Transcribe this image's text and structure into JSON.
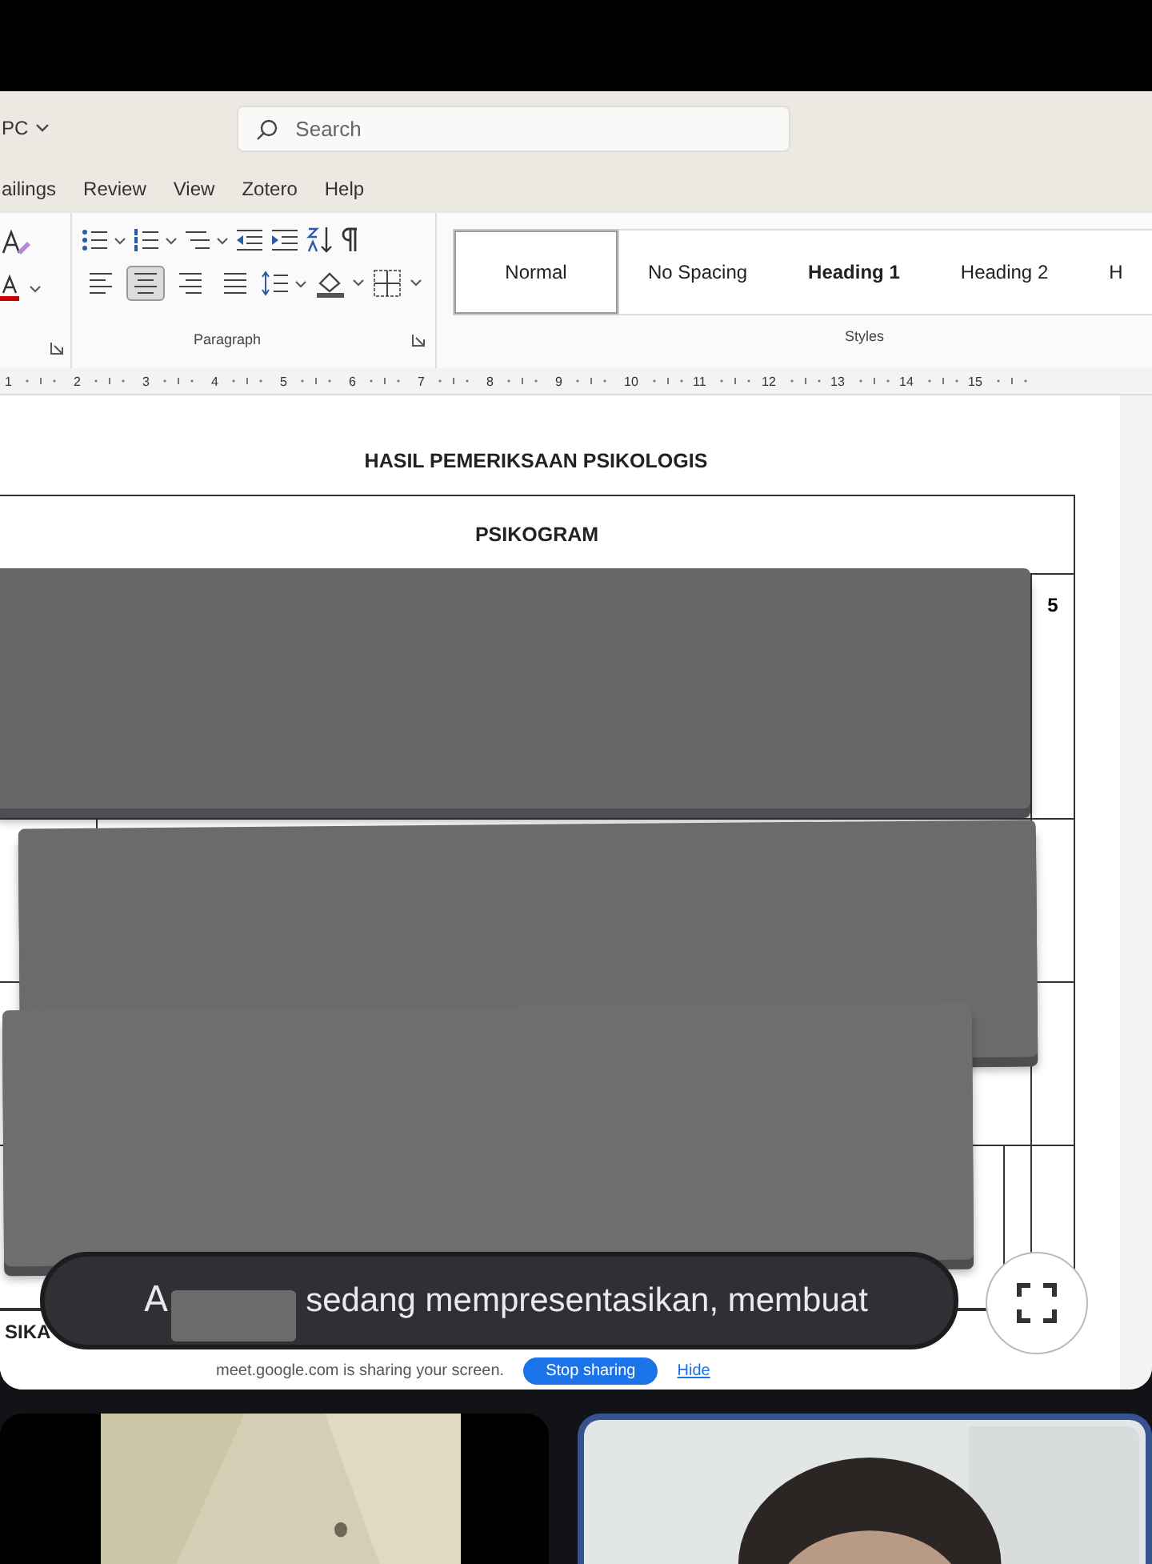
{
  "title_bar": {
    "account": "PC",
    "search": {
      "placeholder": "Search"
    }
  },
  "menu": [
    {
      "label": "ailings"
    },
    {
      "label": "Review"
    },
    {
      "label": "View"
    },
    {
      "label": "Zotero"
    },
    {
      "label": "Help"
    }
  ],
  "ribbon": {
    "paragraph_label": "Paragraph",
    "styles_label": "Styles",
    "alignment": [
      {
        "kind": "left",
        "selected": false
      },
      {
        "kind": "center",
        "selected": true
      },
      {
        "kind": "right",
        "selected": false
      },
      {
        "kind": "justify",
        "selected": false
      }
    ],
    "styles": [
      {
        "label": "Normal",
        "selected": true,
        "bold": false
      },
      {
        "label": "No Spacing",
        "selected": false,
        "bold": false
      },
      {
        "label": "Heading 1",
        "selected": false,
        "bold": true
      },
      {
        "label": "Heading 2",
        "selected": false,
        "bold": false
      },
      {
        "label": "H",
        "selected": false,
        "bold": false
      }
    ]
  },
  "ruler": [
    "1",
    "2",
    "3",
    "4",
    "5",
    "6",
    "7",
    "8",
    "9",
    "10",
    "11",
    "12",
    "13",
    "14",
    "15"
  ],
  "document": {
    "heading": "HASIL PEMERIKSAAN PSIKOLOGIS",
    "table_title": "PSIKOGRAM",
    "score_header": "5",
    "next_section": "SIKA"
  },
  "share_bar": {
    "message": "meet.google.com is sharing your screen.",
    "stop": "Stop sharing",
    "hide": "Hide"
  },
  "caption": {
    "prefix": "A",
    "text": "sedang mempresentasikan, membuat"
  },
  "tiles": [
    {
      "kind": "picture",
      "active": false
    },
    {
      "kind": "picture",
      "active": true
    }
  ]
}
